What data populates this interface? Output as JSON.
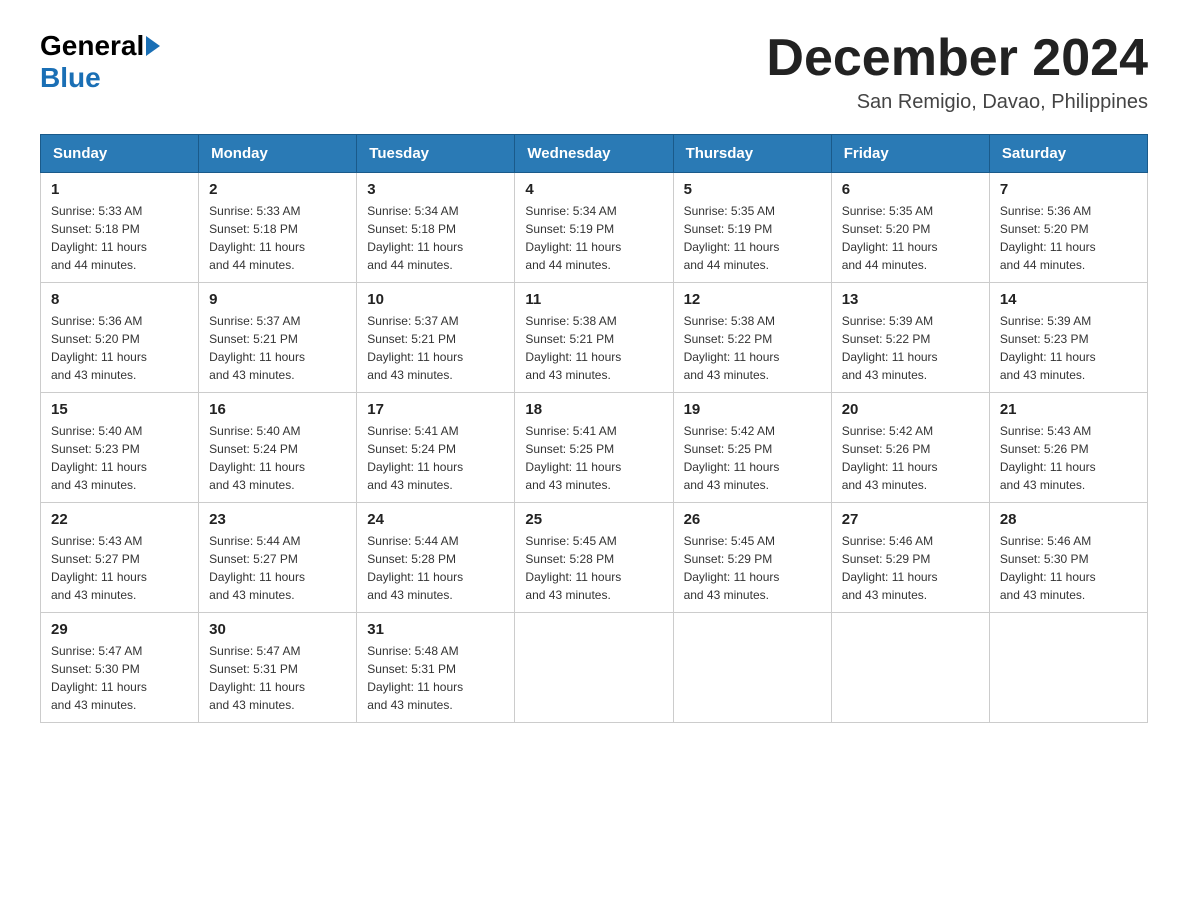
{
  "header": {
    "logo_general": "General",
    "logo_blue": "Blue",
    "month_title": "December 2024",
    "location": "San Remigio, Davao, Philippines"
  },
  "weekdays": [
    "Sunday",
    "Monday",
    "Tuesday",
    "Wednesday",
    "Thursday",
    "Friday",
    "Saturday"
  ],
  "weeks": [
    [
      {
        "day": "1",
        "sunrise": "5:33 AM",
        "sunset": "5:18 PM",
        "daylight": "11 hours and 44 minutes."
      },
      {
        "day": "2",
        "sunrise": "5:33 AM",
        "sunset": "5:18 PM",
        "daylight": "11 hours and 44 minutes."
      },
      {
        "day": "3",
        "sunrise": "5:34 AM",
        "sunset": "5:18 PM",
        "daylight": "11 hours and 44 minutes."
      },
      {
        "day": "4",
        "sunrise": "5:34 AM",
        "sunset": "5:19 PM",
        "daylight": "11 hours and 44 minutes."
      },
      {
        "day": "5",
        "sunrise": "5:35 AM",
        "sunset": "5:19 PM",
        "daylight": "11 hours and 44 minutes."
      },
      {
        "day": "6",
        "sunrise": "5:35 AM",
        "sunset": "5:20 PM",
        "daylight": "11 hours and 44 minutes."
      },
      {
        "day": "7",
        "sunrise": "5:36 AM",
        "sunset": "5:20 PM",
        "daylight": "11 hours and 44 minutes."
      }
    ],
    [
      {
        "day": "8",
        "sunrise": "5:36 AM",
        "sunset": "5:20 PM",
        "daylight": "11 hours and 43 minutes."
      },
      {
        "day": "9",
        "sunrise": "5:37 AM",
        "sunset": "5:21 PM",
        "daylight": "11 hours and 43 minutes."
      },
      {
        "day": "10",
        "sunrise": "5:37 AM",
        "sunset": "5:21 PM",
        "daylight": "11 hours and 43 minutes."
      },
      {
        "day": "11",
        "sunrise": "5:38 AM",
        "sunset": "5:21 PM",
        "daylight": "11 hours and 43 minutes."
      },
      {
        "day": "12",
        "sunrise": "5:38 AM",
        "sunset": "5:22 PM",
        "daylight": "11 hours and 43 minutes."
      },
      {
        "day": "13",
        "sunrise": "5:39 AM",
        "sunset": "5:22 PM",
        "daylight": "11 hours and 43 minutes."
      },
      {
        "day": "14",
        "sunrise": "5:39 AM",
        "sunset": "5:23 PM",
        "daylight": "11 hours and 43 minutes."
      }
    ],
    [
      {
        "day": "15",
        "sunrise": "5:40 AM",
        "sunset": "5:23 PM",
        "daylight": "11 hours and 43 minutes."
      },
      {
        "day": "16",
        "sunrise": "5:40 AM",
        "sunset": "5:24 PM",
        "daylight": "11 hours and 43 minutes."
      },
      {
        "day": "17",
        "sunrise": "5:41 AM",
        "sunset": "5:24 PM",
        "daylight": "11 hours and 43 minutes."
      },
      {
        "day": "18",
        "sunrise": "5:41 AM",
        "sunset": "5:25 PM",
        "daylight": "11 hours and 43 minutes."
      },
      {
        "day": "19",
        "sunrise": "5:42 AM",
        "sunset": "5:25 PM",
        "daylight": "11 hours and 43 minutes."
      },
      {
        "day": "20",
        "sunrise": "5:42 AM",
        "sunset": "5:26 PM",
        "daylight": "11 hours and 43 minutes."
      },
      {
        "day": "21",
        "sunrise": "5:43 AM",
        "sunset": "5:26 PM",
        "daylight": "11 hours and 43 minutes."
      }
    ],
    [
      {
        "day": "22",
        "sunrise": "5:43 AM",
        "sunset": "5:27 PM",
        "daylight": "11 hours and 43 minutes."
      },
      {
        "day": "23",
        "sunrise": "5:44 AM",
        "sunset": "5:27 PM",
        "daylight": "11 hours and 43 minutes."
      },
      {
        "day": "24",
        "sunrise": "5:44 AM",
        "sunset": "5:28 PM",
        "daylight": "11 hours and 43 minutes."
      },
      {
        "day": "25",
        "sunrise": "5:45 AM",
        "sunset": "5:28 PM",
        "daylight": "11 hours and 43 minutes."
      },
      {
        "day": "26",
        "sunrise": "5:45 AM",
        "sunset": "5:29 PM",
        "daylight": "11 hours and 43 minutes."
      },
      {
        "day": "27",
        "sunrise": "5:46 AM",
        "sunset": "5:29 PM",
        "daylight": "11 hours and 43 minutes."
      },
      {
        "day": "28",
        "sunrise": "5:46 AM",
        "sunset": "5:30 PM",
        "daylight": "11 hours and 43 minutes."
      }
    ],
    [
      {
        "day": "29",
        "sunrise": "5:47 AM",
        "sunset": "5:30 PM",
        "daylight": "11 hours and 43 minutes."
      },
      {
        "day": "30",
        "sunrise": "5:47 AM",
        "sunset": "5:31 PM",
        "daylight": "11 hours and 43 minutes."
      },
      {
        "day": "31",
        "sunrise": "5:48 AM",
        "sunset": "5:31 PM",
        "daylight": "11 hours and 43 minutes."
      },
      null,
      null,
      null,
      null
    ]
  ],
  "labels": {
    "sunrise": "Sunrise:",
    "sunset": "Sunset:",
    "daylight": "Daylight:"
  }
}
